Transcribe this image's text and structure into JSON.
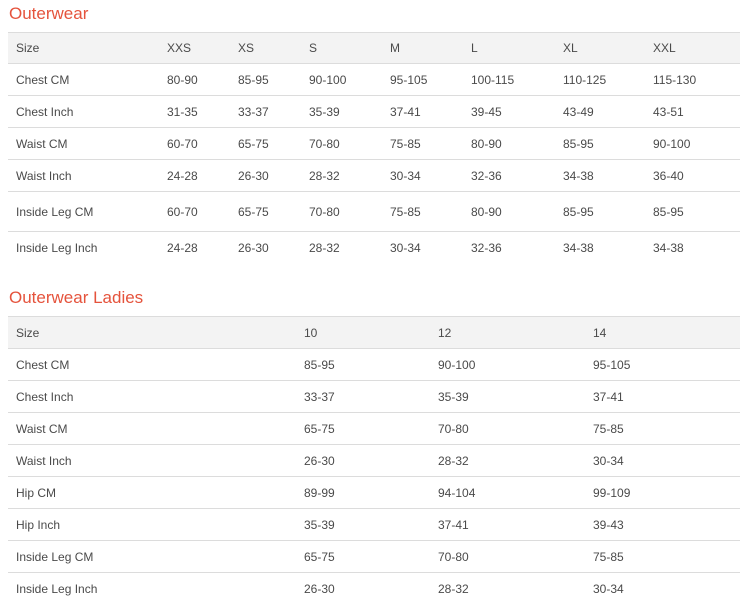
{
  "outerwear": {
    "title": "Outerwear",
    "headers": [
      "Size",
      "XXS",
      "XS",
      "S",
      "M",
      "L",
      "XL",
      "XXL"
    ],
    "rows": [
      [
        "Chest CM",
        "80-90",
        "85-95",
        "90-100",
        "95-105",
        "100-115",
        "110-125",
        "115-130"
      ],
      [
        "Chest Inch",
        "31-35",
        "33-37",
        "35-39",
        "37-41",
        "39-45",
        "43-49",
        "43-51"
      ],
      [
        "Waist CM",
        "60-70",
        "65-75",
        "70-80",
        "75-85",
        "80-90",
        "85-95",
        "90-100"
      ],
      [
        "Waist Inch",
        "24-28",
        "26-30",
        "28-32",
        "30-34",
        "32-36",
        "34-38",
        "36-40"
      ],
      [
        "Inside Leg CM",
        "60-70",
        "65-75",
        "70-80",
        "75-85",
        "80-90",
        "85-95",
        "85-95"
      ],
      [
        "Inside Leg Inch",
        "24-28",
        "26-30",
        "28-32",
        "30-34",
        "32-36",
        "34-38",
        "34-38"
      ]
    ]
  },
  "outerwear_ladies": {
    "title": "Outerwear Ladies",
    "headers": [
      "Size",
      "10",
      "12",
      "14"
    ],
    "rows": [
      [
        "Chest CM",
        "85-95",
        "90-100",
        "95-105"
      ],
      [
        "Chest Inch",
        "33-37",
        "35-39",
        "37-41"
      ],
      [
        "Waist CM",
        "65-75",
        "70-80",
        "75-85"
      ],
      [
        "Waist Inch",
        "26-30",
        "28-32",
        "30-34"
      ],
      [
        "Hip CM",
        "89-99",
        "94-104",
        "99-109"
      ],
      [
        "Hip Inch",
        "35-39",
        "37-41",
        "39-43"
      ],
      [
        "Inside Leg CM",
        "65-75",
        "70-80",
        "75-85"
      ],
      [
        "Inside Leg Inch",
        "26-30",
        "28-32",
        "30-34"
      ]
    ]
  }
}
